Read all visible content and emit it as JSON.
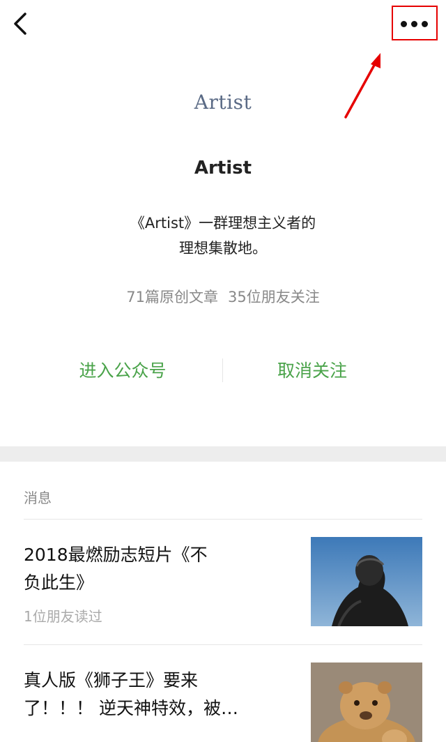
{
  "header": {
    "back_icon": "chevron-left-icon",
    "more_icon": "more-dots-icon",
    "annotation_color": "#e60000"
  },
  "profile": {
    "logo_text": "Artist",
    "name": "Artist",
    "description_line1": "《Artist》一群理想主义者的",
    "description_line2": "理想集散地。",
    "articles_count": "71篇原创文章",
    "friends_following": "35位朋友关注"
  },
  "actions": {
    "enter_label": "进入公众号",
    "unfollow_label": "取消关注",
    "accent_color": "#4aa34a"
  },
  "messages": {
    "section_title": "消息",
    "items": [
      {
        "title_line1": "2018最燃励志短片《不",
        "title_line2": "负此生》",
        "meta": "1位朋友读过"
      },
      {
        "title_line1": "真人版《狮子王》要来",
        "title_line2": "了！！！ 逆天神特效，被…"
      }
    ]
  }
}
